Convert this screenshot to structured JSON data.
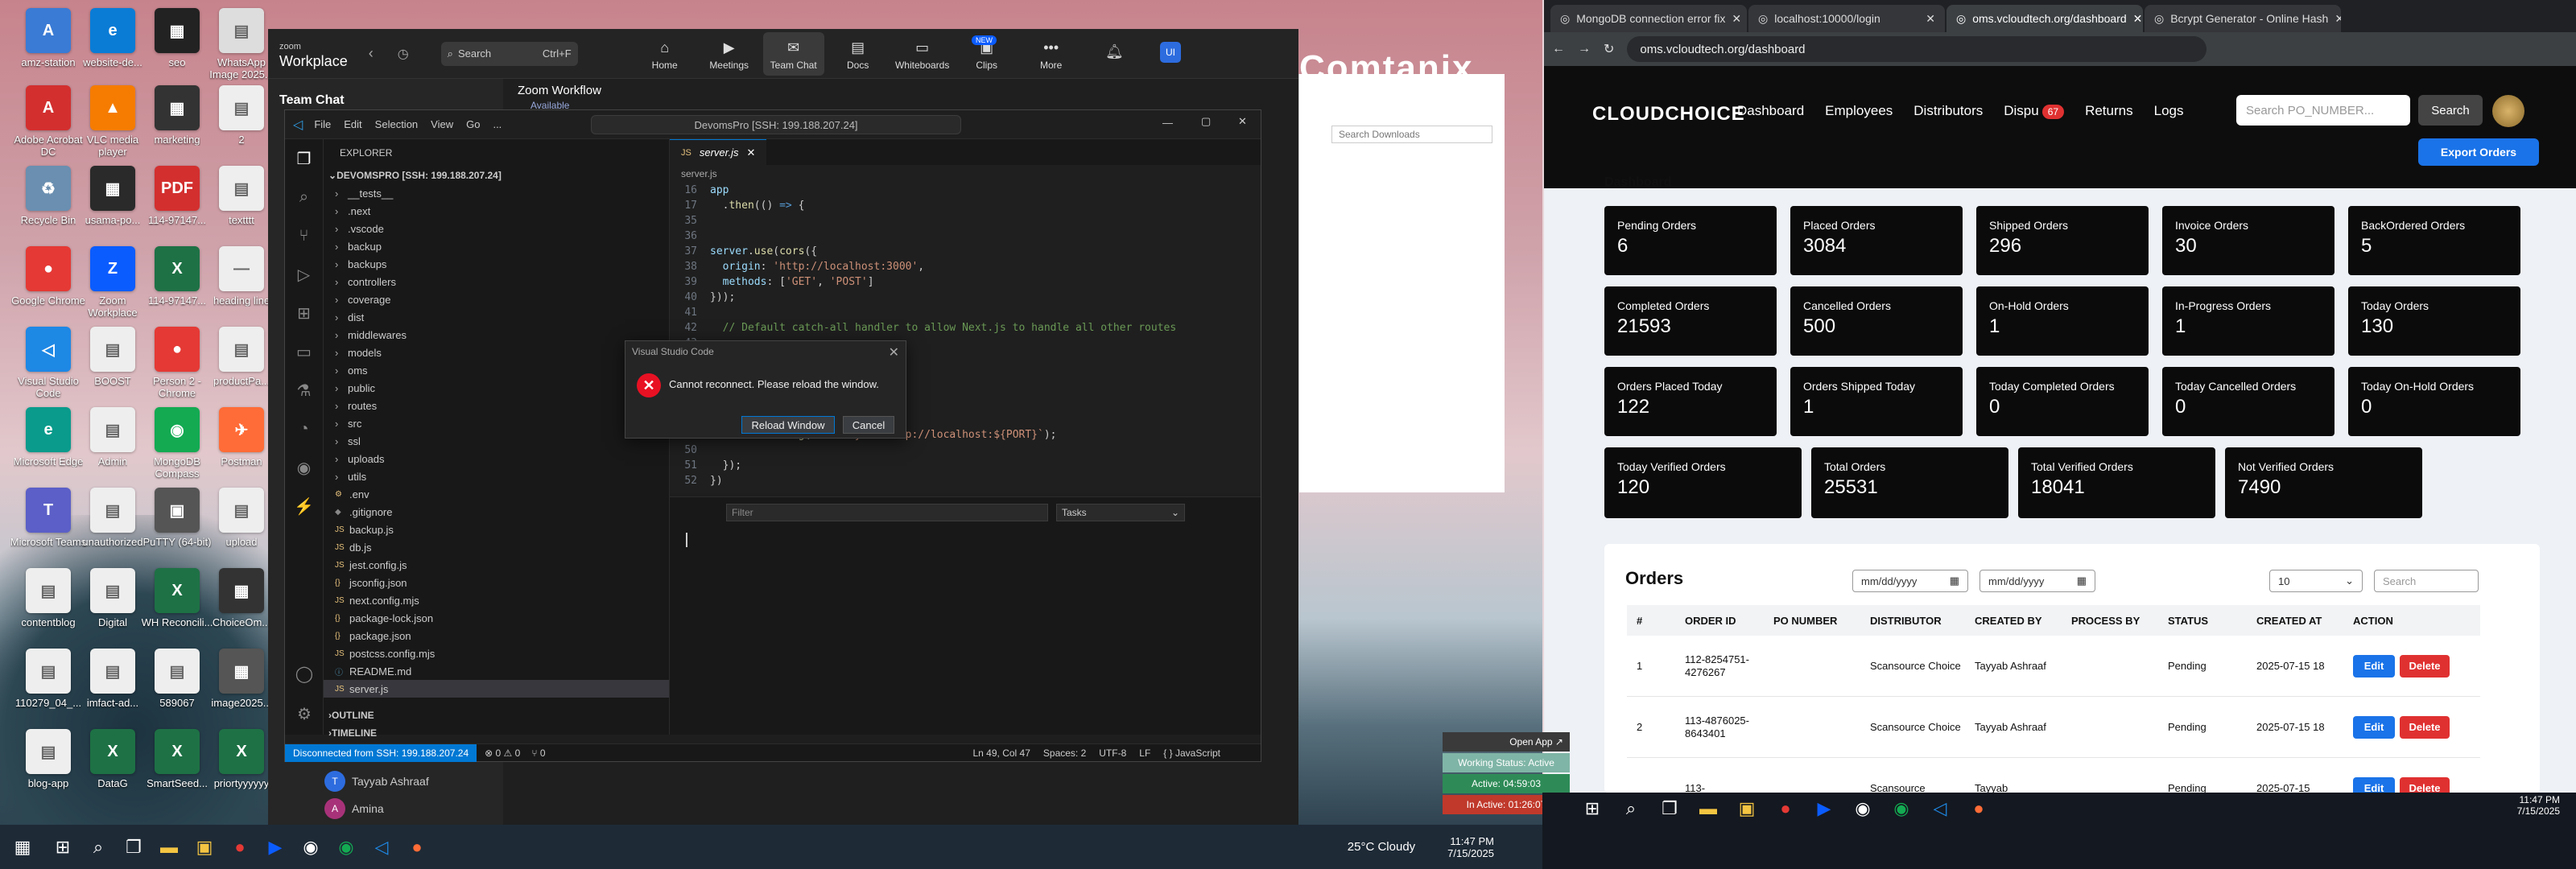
{
  "desktop": {
    "icons": [
      {
        "label": "amz-station",
        "color": "#3a7bd5",
        "glyph": "A"
      },
      {
        "label": "website-de...",
        "color": "#0a7cd6",
        "glyph": "e"
      },
      {
        "label": "seo",
        "color": "#222",
        "glyph": "▦"
      },
      {
        "label": "WhatsApp Image 2025...",
        "color": "#ddd",
        "glyph": "▤"
      },
      {
        "label": "Adobe Acrobat DC",
        "color": "#d32f2f",
        "glyph": "A"
      },
      {
        "label": "VLC media player",
        "color": "#f57c00",
        "glyph": "▲"
      },
      {
        "label": "marketing",
        "color": "#333",
        "glyph": "▦"
      },
      {
        "label": "2",
        "color": "#eee",
        "glyph": "▤"
      },
      {
        "label": "Recycle Bin",
        "color": "#6a8fb0",
        "glyph": "♻"
      },
      {
        "label": "usama-po...",
        "color": "#2a2a2a",
        "glyph": "▦"
      },
      {
        "label": "114-97147...",
        "color": "#d32f2f",
        "glyph": "PDF"
      },
      {
        "label": "textttt",
        "color": "#eee",
        "glyph": "▤"
      },
      {
        "label": "Google Chrome",
        "color": "#e53935",
        "glyph": "●"
      },
      {
        "label": "Zoom Workplace",
        "color": "#0b5cff",
        "glyph": "Z"
      },
      {
        "label": "114-97147...",
        "color": "#1e7145",
        "glyph": "X"
      },
      {
        "label": "heading line",
        "color": "#eee",
        "glyph": "—"
      },
      {
        "label": "Visual Studio Code",
        "color": "#1e88e5",
        "glyph": "◁"
      },
      {
        "label": "BOOST",
        "color": "#eee",
        "glyph": "▤"
      },
      {
        "label": "Person 2 - Chrome",
        "color": "#e53935",
        "glyph": "●"
      },
      {
        "label": "productPa...",
        "color": "#eee",
        "glyph": "▤"
      },
      {
        "label": "Microsoft Edge",
        "color": "#0a9b8c",
        "glyph": "e"
      },
      {
        "label": "Admin",
        "color": "#eee",
        "glyph": "▤"
      },
      {
        "label": "MongoDB Compass",
        "color": "#13aa52",
        "glyph": "◉"
      },
      {
        "label": "Postman",
        "color": "#ff6c37",
        "glyph": "✈"
      },
      {
        "label": "Microsoft Teams",
        "color": "#5b5fc7",
        "glyph": "T"
      },
      {
        "label": "unauthorized",
        "color": "#eee",
        "glyph": "▤"
      },
      {
        "label": "PuTTY (64-bit)",
        "color": "#555",
        "glyph": "▣"
      },
      {
        "label": "upload",
        "color": "#eee",
        "glyph": "▤"
      },
      {
        "label": "contentblog",
        "color": "#eee",
        "glyph": "▤"
      },
      {
        "label": "Digital",
        "color": "#eee",
        "glyph": "▤"
      },
      {
        "label": "WH Reconcili...",
        "color": "#1e7145",
        "glyph": "X"
      },
      {
        "label": "ChoiceOm...",
        "color": "#333",
        "glyph": "▦"
      },
      {
        "label": "110279_04_...",
        "color": "#eee",
        "glyph": "▤"
      },
      {
        "label": "imfact-ad...",
        "color": "#eee",
        "glyph": "▤"
      },
      {
        "label": "589067",
        "color": "#eee",
        "glyph": "▤"
      },
      {
        "label": "image2025...",
        "color": "#555",
        "glyph": "▦"
      },
      {
        "label": "blog-app",
        "color": "#eee",
        "glyph": "▤"
      },
      {
        "label": "DataG",
        "color": "#1e7145",
        "glyph": "X"
      },
      {
        "label": "SmartSeed...",
        "color": "#1e7145",
        "glyph": "X"
      },
      {
        "label": "priortyyyyyy",
        "color": "#1e7145",
        "glyph": "X"
      }
    ]
  },
  "zoom": {
    "brand": "zoom",
    "brand_sub": "Workplace",
    "search": "Search",
    "shortcut": "Ctrl+F",
    "nav": [
      {
        "label": "Home",
        "glyph": "⌂"
      },
      {
        "label": "Meetings",
        "glyph": "▶"
      },
      {
        "label": "Team Chat",
        "glyph": "✉"
      },
      {
        "label": "Docs",
        "glyph": "▤"
      },
      {
        "label": "Whiteboards",
        "glyph": "▭"
      },
      {
        "label": "Clips",
        "glyph": "▣"
      },
      {
        "label": "More",
        "glyph": "•••"
      }
    ],
    "new_badge": "NEW",
    "avatar": "UI",
    "sidebar_title": "Team Chat",
    "channel": "Zoom Workflow",
    "channel_status": "Available",
    "people": [
      {
        "name": "Tayyab Ashraaf",
        "color": "#2d6cdf",
        "initial": "T"
      },
      {
        "name": "Amina",
        "color": "#a83279",
        "initial": "A"
      }
    ]
  },
  "vscode": {
    "menu": [
      "File",
      "Edit",
      "Selection",
      "View",
      "Go",
      "..."
    ],
    "command_center": "DevomsPro [SSH: 199.188.207.24]",
    "explorer_label": "EXPLORER",
    "root": "DEVOMSPRO [SSH: 199.188.207.24]",
    "tree": [
      {
        "name": "__tests__",
        "type": "folder"
      },
      {
        "name": ".next",
        "type": "folder"
      },
      {
        "name": ".vscode",
        "type": "folder"
      },
      {
        "name": "backup",
        "type": "folder"
      },
      {
        "name": "backups",
        "type": "folder"
      },
      {
        "name": "controllers",
        "type": "folder"
      },
      {
        "name": "coverage",
        "type": "folder"
      },
      {
        "name": "dist",
        "type": "folder"
      },
      {
        "name": "middlewares",
        "type": "folder"
      },
      {
        "name": "models",
        "type": "folder"
      },
      {
        "name": "oms",
        "type": "folder"
      },
      {
        "name": "public",
        "type": "folder"
      },
      {
        "name": "routes",
        "type": "folder"
      },
      {
        "name": "src",
        "type": "folder"
      },
      {
        "name": "ssl",
        "type": "folder"
      },
      {
        "name": "uploads",
        "type": "folder"
      },
      {
        "name": "utils",
        "type": "folder"
      },
      {
        "name": ".env",
        "type": "file",
        "glyph": "⚙",
        "color": "#e5c07b"
      },
      {
        "name": ".gitignore",
        "type": "file",
        "glyph": "◆",
        "color": "#888"
      },
      {
        "name": "backup.js",
        "type": "file",
        "glyph": "JS",
        "color": "#e5c07b"
      },
      {
        "name": "db.js",
        "type": "file",
        "glyph": "JS",
        "color": "#e5c07b"
      },
      {
        "name": "jest.config.js",
        "type": "file",
        "glyph": "JS",
        "color": "#e5c07b"
      },
      {
        "name": "jsconfig.json",
        "type": "file",
        "glyph": "{}",
        "color": "#e5c07b"
      },
      {
        "name": "next.config.mjs",
        "type": "file",
        "glyph": "JS",
        "color": "#e5c07b"
      },
      {
        "name": "package-lock.json",
        "type": "file",
        "glyph": "{}",
        "color": "#e5c07b"
      },
      {
        "name": "package.json",
        "type": "file",
        "glyph": "{}",
        "color": "#e5c07b"
      },
      {
        "name": "postcss.config.mjs",
        "type": "file",
        "glyph": "JS",
        "color": "#e5c07b"
      },
      {
        "name": "README.md",
        "type": "file",
        "glyph": "ⓘ",
        "color": "#519aba"
      },
      {
        "name": "server.js",
        "type": "file",
        "glyph": "JS",
        "color": "#e5c07b",
        "selected": true
      }
    ],
    "outline": "OUTLINE",
    "timeline": "TIMELINE",
    "tab": "server.js",
    "breadcrumb": "server.js",
    "code": [
      {
        "n": "16",
        "html": "<span class='var'>app</span>"
      },
      {
        "n": "17",
        "html": "  .<span class='fn'>then</span>(() <span class='kw'>=&gt;</span> {"
      },
      {
        "n": "35",
        "html": ""
      },
      {
        "n": "36",
        "html": ""
      },
      {
        "n": "37",
        "html": "<span class='var'>server</span>.<span class='fn'>use</span>(<span class='fn'>cors</span>({"
      },
      {
        "n": "38",
        "html": "  <span class='var'>origin</span>: <span class='str'>'http://localhost:3000'</span>,"
      },
      {
        "n": "39",
        "html": "  <span class='var'>methods</span>: [<span class='str'>'GET'</span>, <span class='str'>'POST'</span>]"
      },
      {
        "n": "40",
        "html": "}));"
      },
      {
        "n": "41",
        "html": ""
      },
      {
        "n": "42",
        "html": "  <span class='cm'>// Default catch-all handler to allow Next.js to handle all other routes</span>"
      },
      {
        "n": "43",
        "html": ""
      },
      {
        "n": "44",
        "html": ""
      },
      {
        "n": "45",
        "html": ""
      },
      {
        "n": "46",
        "html": ""
      },
      {
        "n": "47",
        "html": ""
      },
      {
        "n": "48",
        "html": ""
      },
      {
        "n": "49",
        "html": "    <span class='var'>console</span>.<span class='fn'>log</span>(<span class='str'>`&gt; Ready on http://localhost:${PORT}`</span>);"
      },
      {
        "n": "50",
        "html": ""
      },
      {
        "n": "51",
        "html": "  });"
      },
      {
        "n": "52",
        "html": "})"
      }
    ],
    "panel_filter": "Filter",
    "panel_tasks": "Tasks",
    "status_remote": "Disconnected from SSH: 199.188.207.24",
    "status_problems": "⊗ 0 ⚠ 0",
    "status_ports": "⑂ 0",
    "status_pos": "Ln 49, Col 47",
    "status_spaces": "Spaces: 2",
    "status_enc": "UTF-8",
    "status_eol": "LF",
    "status_lang": "{ } JavaScript",
    "dialog_title": "Visual Studio Code",
    "dialog_msg": "Cannot reconnect. Please reload the window.",
    "dialog_reload": "Reload Window",
    "dialog_cancel": "Cancel"
  },
  "filewin": {
    "search": "Search Downloads"
  },
  "bg_banner": "Comtanix",
  "browser": {
    "tabs": [
      {
        "label": "MongoDB connection error fix"
      },
      {
        "label": "localhost:10000/login"
      },
      {
        "label": "oms.vcloudtech.org/dashboard",
        "active": true
      },
      {
        "label": "Bcrypt Generator - Online Hash"
      }
    ],
    "url": "oms.vcloudtech.org/dashboard",
    "app": {
      "logo": "CLOUDCHOICE",
      "nav": [
        "Dashboard",
        "Employees",
        "Distributors",
        "Dispu",
        "Returns",
        "Logs"
      ],
      "disputes_badge": "67",
      "search_placeholder": "Search PO_NUMBER...",
      "search_btn": "Search",
      "dashboard_title": "Dashboard",
      "export_btn": "Export Orders",
      "stats": [
        {
          "label": "Pending Orders",
          "value": "6"
        },
        {
          "label": "Placed Orders",
          "value": "3084"
        },
        {
          "label": "Shipped Orders",
          "value": "296"
        },
        {
          "label": "Invoice Orders",
          "value": "30"
        },
        {
          "label": "BackOrdered Orders",
          "value": "5"
        },
        {
          "label": "Completed Orders",
          "value": "21593"
        },
        {
          "label": "Cancelled Orders",
          "value": "500"
        },
        {
          "label": "On-Hold Orders",
          "value": "1"
        },
        {
          "label": "In-Progress Orders",
          "value": "1"
        },
        {
          "label": "Today Orders",
          "value": "130"
        },
        {
          "label": "Orders Placed Today",
          "value": "122"
        },
        {
          "label": "Orders Shipped Today",
          "value": "1"
        },
        {
          "label": "Today Completed Orders",
          "value": "0"
        },
        {
          "label": "Today Cancelled Orders",
          "value": "0"
        },
        {
          "label": "Today On-Hold Orders",
          "value": "0"
        }
      ],
      "stats_row4": [
        {
          "label": "Today Verified Orders",
          "value": "120"
        },
        {
          "label": "Total Orders",
          "value": "25531"
        },
        {
          "label": "Total Verified Orders",
          "value": "18041"
        },
        {
          "label": "Not Verified Orders",
          "value": "7490"
        }
      ],
      "orders_title": "Orders",
      "date_placeholder": "mm/dd/yyyy",
      "page_size": "10",
      "search2": "Search",
      "columns": [
        "#",
        "ORDER ID",
        "PO NUMBER",
        "DISTRIBUTOR",
        "CREATED BY",
        "PROCESS BY",
        "STATUS",
        "CREATED AT",
        "ACTION"
      ],
      "rows": [
        {
          "n": "1",
          "id": "112-8254751-4276267",
          "po": "",
          "dist": "Scansource Choice",
          "by": "Tayyab Ashraaf",
          "proc": "",
          "status": "Pending",
          "at": "2025-07-15 18"
        },
        {
          "n": "2",
          "id": "113-4876025-8643401",
          "po": "",
          "dist": "Scansource Choice",
          "by": "Tayyab Ashraaf",
          "proc": "",
          "status": "Pending",
          "at": "2025-07-15 18"
        },
        {
          "n": "",
          "id": "113-",
          "po": "",
          "dist": "Scansource",
          "by": "Tayyab",
          "proc": "",
          "status": "Pending",
          "at": "2025-07-15"
        }
      ],
      "edit": "Edit",
      "delete": "Delete"
    }
  },
  "tracker": {
    "open": "Open App ↗",
    "working": "Working Status: Active",
    "active": "Active: 04:59:03",
    "inactive": "In Active: 01:26:07"
  },
  "taskbar": {
    "weather": "25°C  Cloudy",
    "time": "11:47 PM",
    "date": "7/15/2025"
  },
  "taskbar2": {
    "time": "11:47 PM",
    "date": "7/15/2025"
  }
}
